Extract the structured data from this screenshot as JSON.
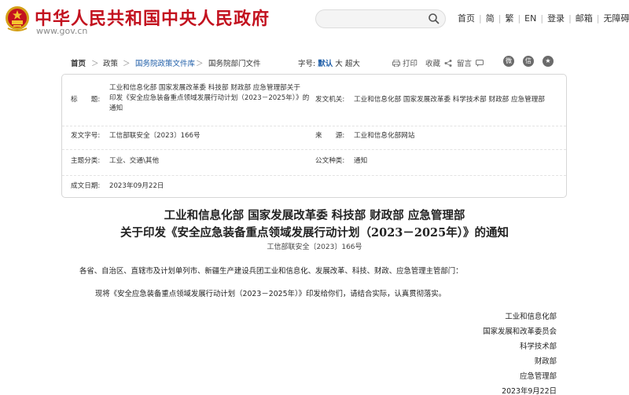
{
  "header": {
    "site_title": "中华人民共和国中央人民政府",
    "site_url": "www.gov.cn",
    "search_placeholder": "",
    "nav": [
      "首页",
      "简",
      "繁",
      "EN",
      "登录",
      "邮箱",
      "无障碍"
    ],
    "colors": {
      "brand": "#c3121f",
      "link": "#1f5ea8"
    }
  },
  "breadcrumb": {
    "items": [
      "首页",
      "政策",
      "国务院政策文件库",
      "国务院部门文件"
    ],
    "separator": "＞",
    "fontsize_label": "字号:",
    "fontsize_options": [
      "默认",
      "大",
      "超大"
    ],
    "print_label": "打印",
    "favorite_label": "收藏",
    "comment_label": "留言",
    "social_icons": [
      "weibo-icon",
      "wechat-icon",
      "star-icon"
    ]
  },
  "info": {
    "title_label": "标　　题:",
    "title_lines": [
      "工业和信息化部 国家发展改革委 科技部 财政部 应急管理部关于",
      "印发《安全应急装备重点领域发展行动计划（2023－2025年）》的",
      "通知"
    ],
    "issuer_label": "发文机关:",
    "issuer_lines": [
      "工业和信息化部 国家发展改革委 科学技术部 财政部 应急管理部"
    ],
    "doc_no_label": "发文字号:",
    "doc_no": "工信部联安全〔2023〕166号",
    "source_label": "来　　源:",
    "source": "工业和信息化部网站",
    "category_label": "主题分类:",
    "category": "工业、交通\\其他",
    "type_label": "公文种类:",
    "type": "通知",
    "date_label": "成文日期:",
    "date": "2023年09月22日"
  },
  "document": {
    "title_line1": "工业和信息化部 国家发展改革委 科技部 财政部 应急管理部",
    "title_line2": "关于印发《安全应急装备重点领域发展行动计划（2023－2025年）》的通知",
    "doc_no": "工信部联安全〔2023〕166号",
    "salutation": "各省、自治区、直辖市及计划单列市、新疆生产建设兵团工业和信息化、发展改革、科技、财政、应急管理主管部门：",
    "body": "现将《安全应急装备重点领域发展行动计划（2023－2025年）》印发给你们，请结合实际，认真贯彻落实。",
    "signatories": [
      "工业和信息化部",
      "国家发展和改革委员会",
      "科学技术部",
      "财政部",
      "应急管理部"
    ],
    "sign_date": "2023年9月22日"
  }
}
